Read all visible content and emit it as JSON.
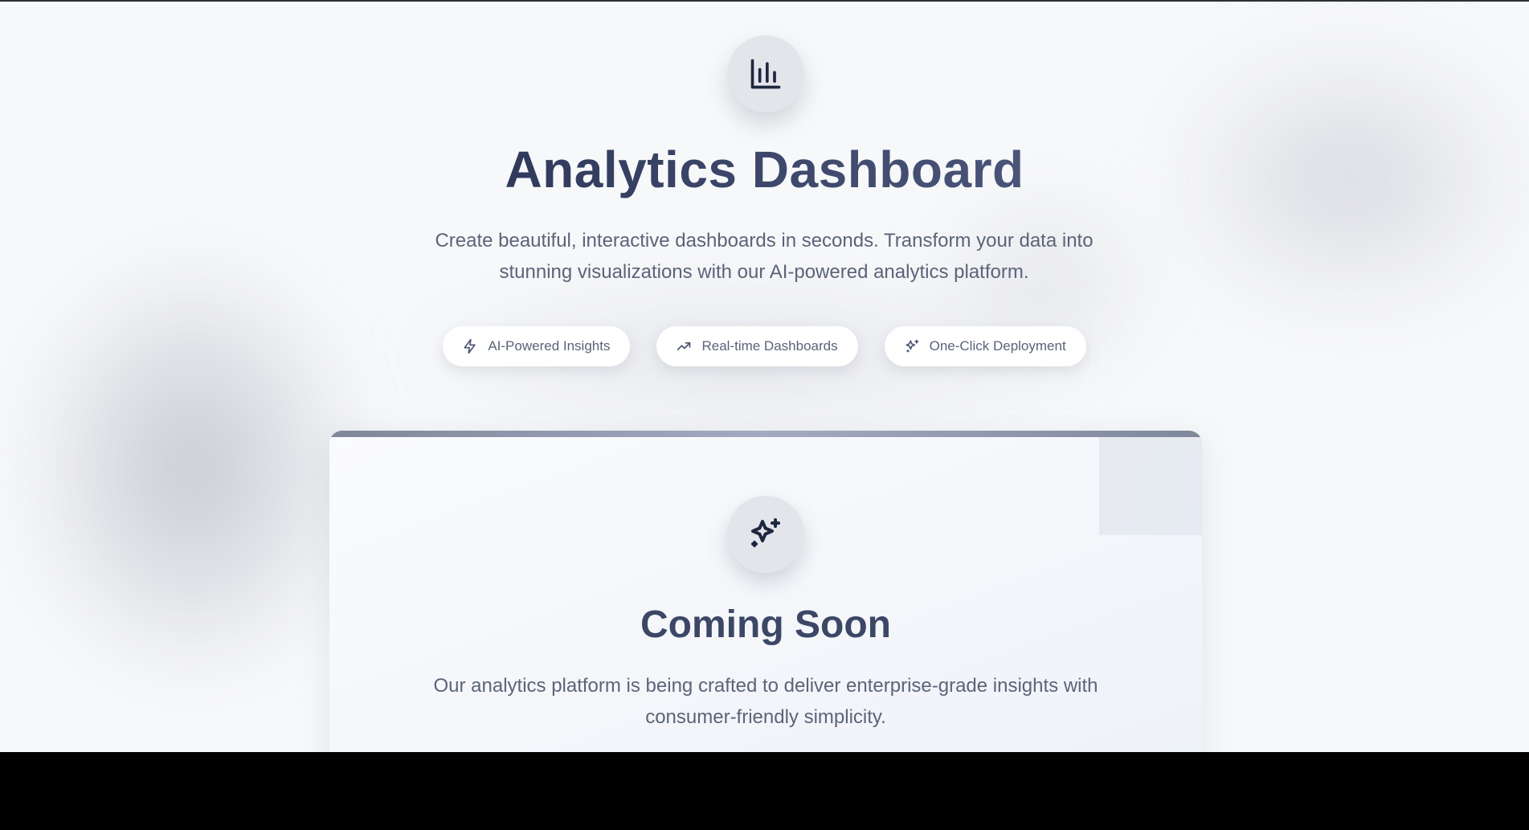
{
  "hero": {
    "icon": "bar-chart-icon",
    "title": "Analytics Dashboard",
    "subtitle": "Create beautiful, interactive dashboards in seconds. Transform your data into stunning visualizations with our AI-powered analytics platform."
  },
  "features": [
    {
      "icon": "zap-icon",
      "label": "AI-Powered Insights"
    },
    {
      "icon": "trending-up-icon",
      "label": "Real-time Dashboards"
    },
    {
      "icon": "sparkles-icon",
      "label": "One-Click Deployment"
    }
  ],
  "coming_soon": {
    "icon": "sparkles-icon",
    "title": "Coming Soon",
    "subtitle": "Our analytics platform is being crafted to deliver enterprise-grade insights with consumer-friendly simplicity."
  },
  "colors": {
    "background": "#f7f8fa",
    "heading": "#3a4568",
    "body_text": "#5b6478",
    "accent_bar": "#8e97ab",
    "icon_dark": "#1f2740"
  }
}
